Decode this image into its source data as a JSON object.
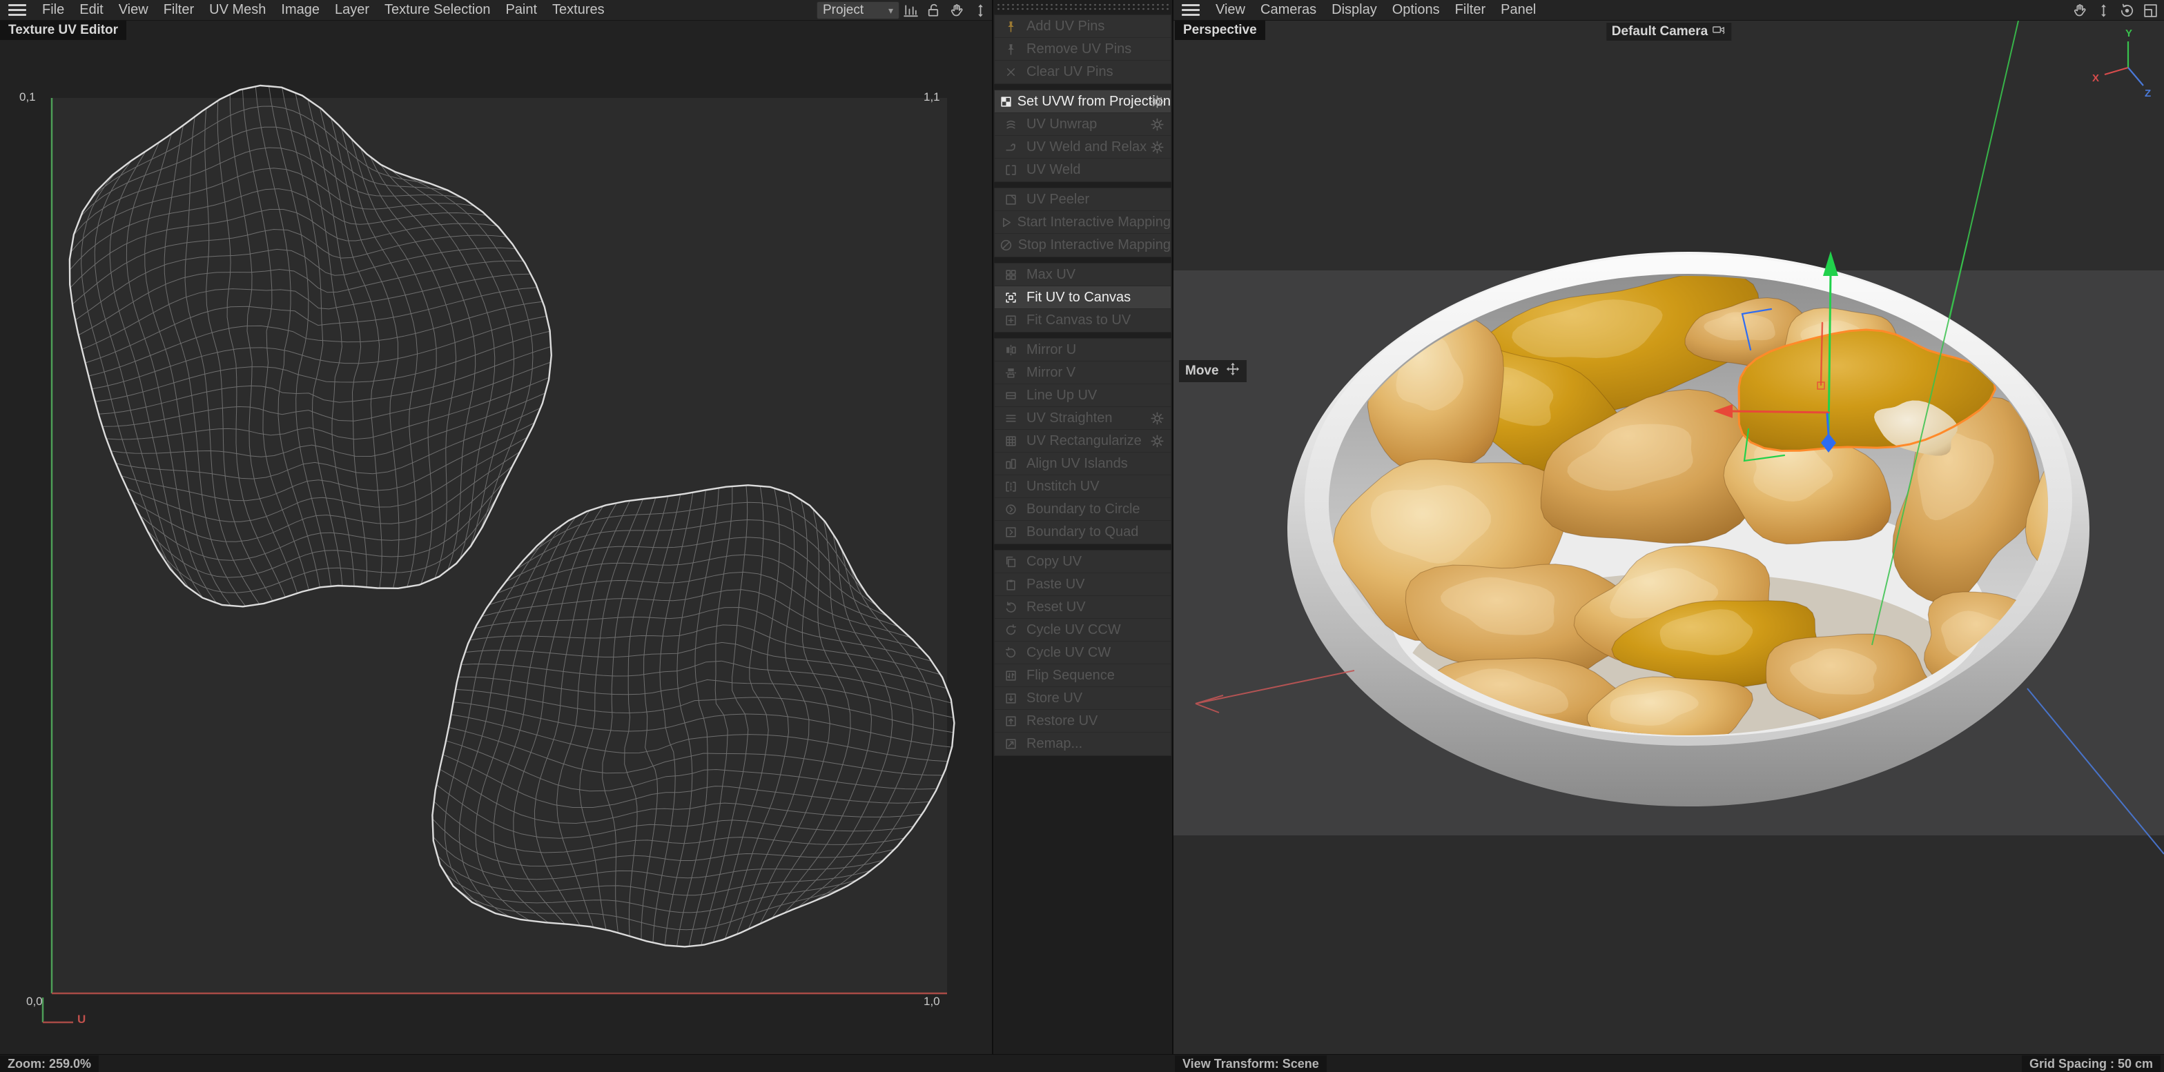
{
  "menubar_left": {
    "items": [
      "File",
      "Edit",
      "View",
      "Filter",
      "UV Mesh",
      "Image",
      "Layer",
      "Texture Selection",
      "Paint",
      "Textures"
    ],
    "project_dropdown": {
      "value": "Project"
    },
    "icons": [
      "histogram-icon",
      "unlock-icon",
      "pan-hand-icon",
      "zoom-updown-icon"
    ]
  },
  "menubar_right": {
    "items": [
      "View",
      "Cameras",
      "Display",
      "Options",
      "Filter",
      "Panel"
    ],
    "corner_icons": [
      "pan-hand-icon",
      "zoom-updown-icon",
      "orbit-icon",
      "maximize-panel-icon"
    ]
  },
  "uv_editor": {
    "tab_title": "Texture UV Editor",
    "corners": {
      "top_left": "0,1",
      "top_right": "1,1",
      "bottom_left": "0,0",
      "bottom_right": "1,0"
    },
    "axis_u_label": "U",
    "status_zoom": "Zoom: 259.0%"
  },
  "uv_palette": {
    "groups": [
      {
        "items": [
          {
            "label": "Add UV Pins",
            "icon": "pin",
            "enabled": false,
            "gear": false,
            "icon_color": "#9c7a33"
          },
          {
            "label": "Remove UV Pins",
            "icon": "pin",
            "enabled": false,
            "gear": false
          },
          {
            "label": "Clear UV Pins",
            "icon": "x-cross",
            "enabled": false,
            "gear": false
          }
        ]
      },
      {
        "items": [
          {
            "label": "Set UVW from Projection",
            "icon": "checker",
            "enabled": true,
            "gear": true
          },
          {
            "label": "UV Unwrap",
            "icon": "unwrap",
            "enabled": false,
            "gear": true
          },
          {
            "label": "UV Weld and Relax",
            "icon": "weld-relax",
            "enabled": false,
            "gear": true
          },
          {
            "label": "UV Weld",
            "icon": "weld",
            "enabled": false,
            "gear": false
          }
        ]
      },
      {
        "items": [
          {
            "label": "UV Peeler",
            "icon": "peeler",
            "enabled": false,
            "gear": false
          },
          {
            "label": "Start Interactive Mapping",
            "icon": "play",
            "enabled": false,
            "gear": false
          },
          {
            "label": "Stop Interactive Mapping",
            "icon": "no-entry",
            "enabled": false,
            "gear": false
          }
        ]
      },
      {
        "items": [
          {
            "label": "Max UV",
            "icon": "max-uv",
            "enabled": false,
            "gear": false
          },
          {
            "label": "Fit UV to Canvas",
            "icon": "fit-uv",
            "enabled": true,
            "gear": false
          },
          {
            "label": "Fit Canvas to UV",
            "icon": "fit-canvas",
            "enabled": false,
            "gear": false
          }
        ]
      },
      {
        "items": [
          {
            "label": "Mirror U",
            "icon": "mirror-u",
            "enabled": false,
            "gear": false
          },
          {
            "label": "Mirror V",
            "icon": "mirror-v",
            "enabled": false,
            "gear": false
          },
          {
            "label": "Line Up UV",
            "icon": "line-up",
            "enabled": false,
            "gear": false
          },
          {
            "label": "UV Straighten",
            "icon": "straighten",
            "enabled": false,
            "gear": true
          },
          {
            "label": "UV Rectangularize",
            "icon": "rectangularize",
            "enabled": false,
            "gear": true
          },
          {
            "label": "Align UV Islands",
            "icon": "align-islands",
            "enabled": false,
            "gear": false
          },
          {
            "label": "Unstitch UV",
            "icon": "unstitch",
            "enabled": false,
            "gear": false
          },
          {
            "label": "Boundary to Circle",
            "icon": "to-circle",
            "enabled": false,
            "gear": false
          },
          {
            "label": "Boundary to Quad",
            "icon": "to-quad",
            "enabled": false,
            "gear": false
          }
        ]
      },
      {
        "items": [
          {
            "label": "Copy UV",
            "icon": "copy",
            "enabled": false,
            "gear": false
          },
          {
            "label": "Paste UV",
            "icon": "paste",
            "enabled": false,
            "gear": false
          },
          {
            "label": "Reset UV",
            "icon": "reset",
            "enabled": false,
            "gear": false
          },
          {
            "label": "Cycle UV CCW",
            "icon": "cycle-ccw",
            "enabled": false,
            "gear": false
          },
          {
            "label": "Cycle UV CW",
            "icon": "cycle-cw",
            "enabled": false,
            "gear": false
          },
          {
            "label": "Flip Sequence",
            "icon": "flip-seq",
            "enabled": false,
            "gear": false
          },
          {
            "label": "Store UV",
            "icon": "store",
            "enabled": false,
            "gear": false
          },
          {
            "label": "Restore UV",
            "icon": "restore",
            "enabled": false,
            "gear": false
          },
          {
            "label": "Remap...",
            "icon": "remap",
            "enabled": false,
            "gear": false
          }
        ]
      }
    ]
  },
  "viewport_3d": {
    "projection_label": "Perspective",
    "camera_label": "Default Camera",
    "active_tool_label": "Move",
    "axis_gizmo_labels": {
      "x": "X",
      "y": "Y",
      "z": "Z"
    },
    "status_view_transform": "View Transform: Scene",
    "status_grid_spacing": "Grid Spacing : 50 cm"
  },
  "colors": {
    "axis_x": "#d84c4c",
    "axis_y": "#39c24d",
    "axis_z": "#4a79d8",
    "gizmo_green": "#21d14b",
    "gizmo_red": "#e84838",
    "gizmo_blue": "#2e6cf2",
    "selection_outline": "#ff8a2a",
    "uv_line": "#767676",
    "uv_boundary": "#dcdcdc",
    "canvas_v_edge": "#4d9e57",
    "canvas_u_edge": "#a94b46",
    "nugget_light": "#e3b76b",
    "nugget_dark": "#cf9a17",
    "bowl": "#e3e3e3"
  }
}
